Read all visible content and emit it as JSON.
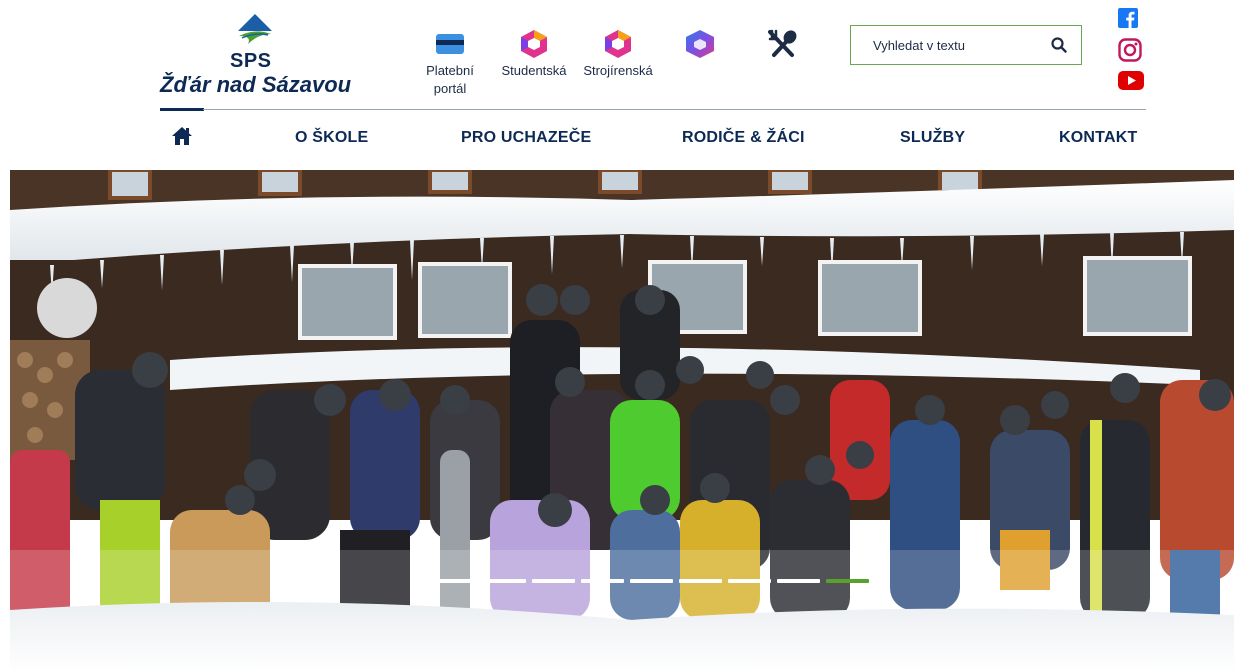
{
  "logo": {
    "abbr": "SPS",
    "town": "Žďár nad Sázavou"
  },
  "quick_links": [
    {
      "label_1": "Platební",
      "label_2": "portál",
      "icon": "payment-card-icon"
    },
    {
      "label_1": "Studentská",
      "label_2": "",
      "icon": "studentska-portal-icon"
    },
    {
      "label_1": "Strojírenská",
      "label_2": "",
      "icon": "strojirenska-portal-icon"
    },
    {
      "label_1": "",
      "label_2": "",
      "icon": "office-icon"
    },
    {
      "label_1": "",
      "label_2": "",
      "icon": "canteen-icon"
    }
  ],
  "search": {
    "placeholder": "Vyhledat v textu",
    "icon": "search-icon"
  },
  "social": [
    "facebook-icon",
    "instagram-icon",
    "youtube-icon"
  ],
  "nav": {
    "home_icon": "home-icon",
    "items": [
      "O ŠKOLE",
      "PRO UCHAZEČE",
      "RODIČE & ŽÁCI",
      "SLUŽBY",
      "KONTAKT"
    ]
  },
  "hero": {
    "slide_count": 9,
    "active_slide": 9
  },
  "colors": {
    "brand_navy": "#0d2a55",
    "accent_green": "#5aa02c",
    "search_border": "#6aa84f"
  }
}
